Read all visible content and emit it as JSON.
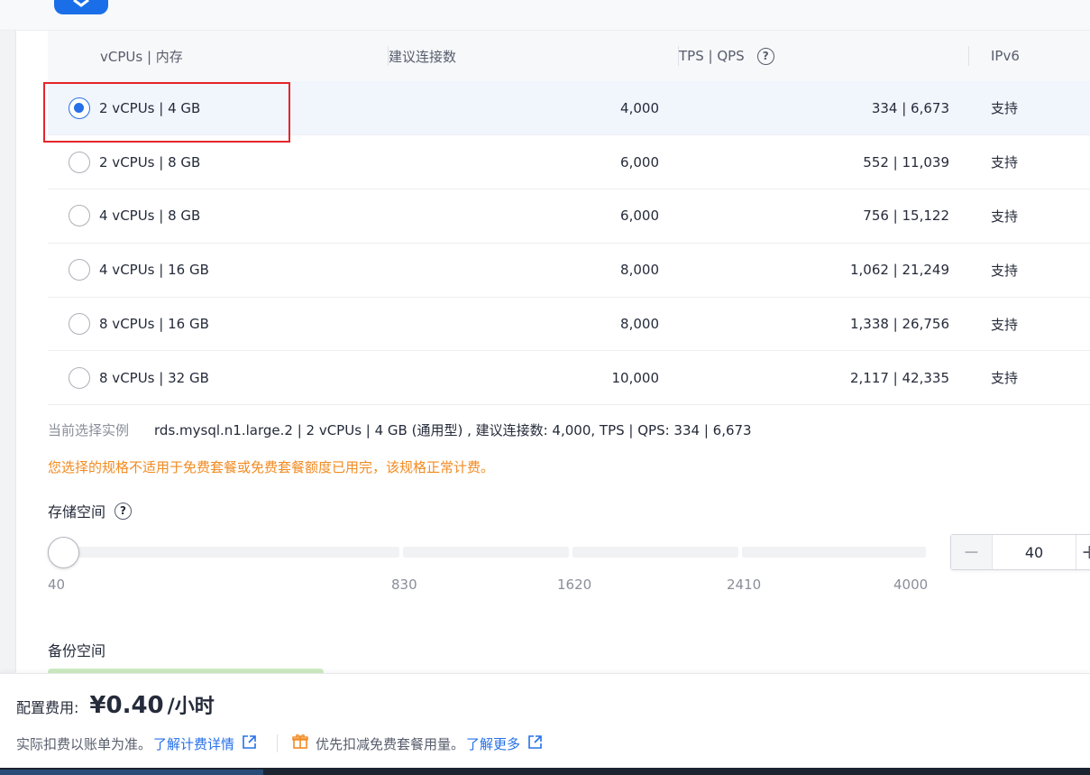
{
  "table": {
    "headers": {
      "spec": "vCPUs | 内存",
      "connections": "建议连接数",
      "tps_qps": "TPS | QPS",
      "ipv6": "IPv6"
    },
    "rows": [
      {
        "spec": "2 vCPUs | 4 GB",
        "connections": "4,000",
        "tps_qps": "334 | 6,673",
        "ipv6": "支持",
        "selected": true
      },
      {
        "spec": "2 vCPUs | 8 GB",
        "connections": "6,000",
        "tps_qps": "552 | 11,039",
        "ipv6": "支持",
        "selected": false
      },
      {
        "spec": "4 vCPUs | 8 GB",
        "connections": "6,000",
        "tps_qps": "756 | 15,122",
        "ipv6": "支持",
        "selected": false
      },
      {
        "spec": "4 vCPUs | 16 GB",
        "connections": "8,000",
        "tps_qps": "1,062 | 21,249",
        "ipv6": "支持",
        "selected": false
      },
      {
        "spec": "8 vCPUs | 16 GB",
        "connections": "8,000",
        "tps_qps": "1,338 | 26,756",
        "ipv6": "支持",
        "selected": false
      },
      {
        "spec": "8 vCPUs | 32 GB",
        "connections": "10,000",
        "tps_qps": "2,117 | 42,335",
        "ipv6": "支持",
        "selected": false
      }
    ]
  },
  "current_selection": {
    "label": "当前选择实例",
    "value": "rds.mysql.n1.large.2 | 2 vCPUs | 4 GB (通用型) , 建议连接数: 4,000, TPS | QPS: 334 | 6,673"
  },
  "warning": "您选择的规格不适用于免费套餐或免费套餐额度已用完，该规格正常计费。",
  "storage": {
    "title": "存储空间",
    "ticks": [
      "40",
      "830",
      "1620",
      "2410",
      "4000"
    ],
    "value": "40",
    "slider_fraction": 0
  },
  "backup": {
    "title": "备份空间"
  },
  "footer": {
    "fee_label": "配置费用:",
    "fee_amount": "¥0.40",
    "fee_unit": "/小时",
    "note": "实际扣费以账单为准。",
    "details_link": "了解计费详情",
    "free_note": "优先扣减免费套餐用量。",
    "more_link": "了解更多"
  },
  "colors": {
    "primary": "#2670e8",
    "warning": "#f28b22",
    "highlight_box": "#e5252a",
    "selected_row": "#f1f5fc"
  },
  "icons": [
    "help-icon",
    "external-link-icon",
    "gift-icon",
    "minus-icon",
    "plus-icon"
  ]
}
